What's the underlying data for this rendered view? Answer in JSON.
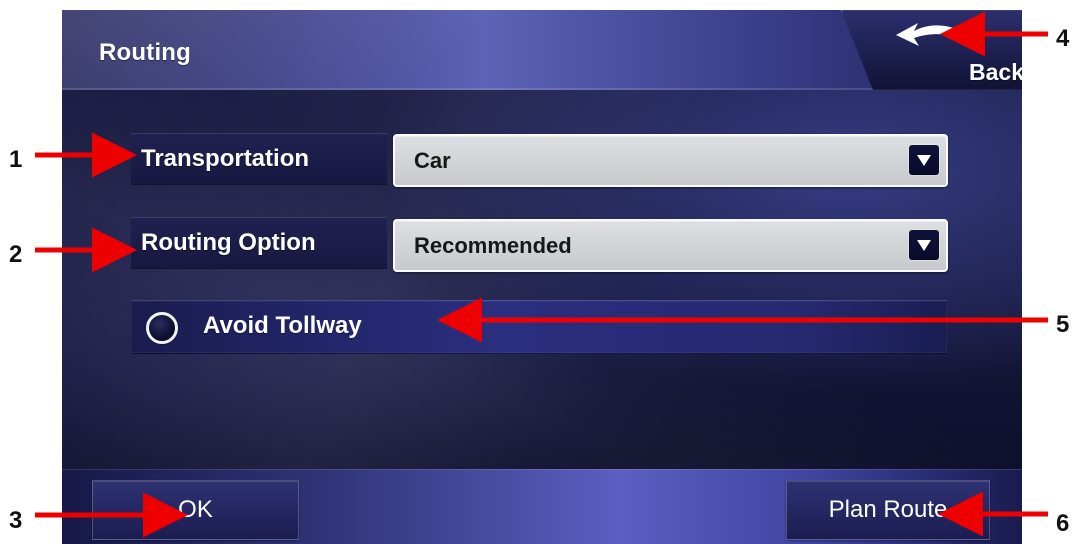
{
  "window": {
    "title": "Routing"
  },
  "header": {
    "back_label": "Back",
    "back_icon": "back-arrow-icon"
  },
  "fields": {
    "transportation": {
      "label": "Transportation",
      "value": "Car",
      "dropdown_icon": "chevron-down-icon"
    },
    "routing_option": {
      "label": "Routing Option",
      "value": "Recommended",
      "dropdown_icon": "chevron-down-icon"
    }
  },
  "options": {
    "avoid_tollway": {
      "label": "Avoid Tollway",
      "selected": false,
      "icon": "radio-button-icon"
    }
  },
  "footer": {
    "ok_label": "OK",
    "plan_route_label": "Plan Route"
  },
  "callouts": {
    "transportation": "1",
    "routing_option": "2",
    "ok": "3",
    "back": "4",
    "avoid_tollway": "5",
    "plan_route": "6"
  },
  "colors": {
    "screen_background": "#16183c",
    "header_gradient_light": "#5d63b6",
    "panel_dark": "#171840",
    "dropdown_field": "#d8d9dc",
    "dropdown_button": "#10113a",
    "callout_arrow": "#ef0000",
    "text_primary": "#ffffff",
    "field_text": "#171717"
  }
}
